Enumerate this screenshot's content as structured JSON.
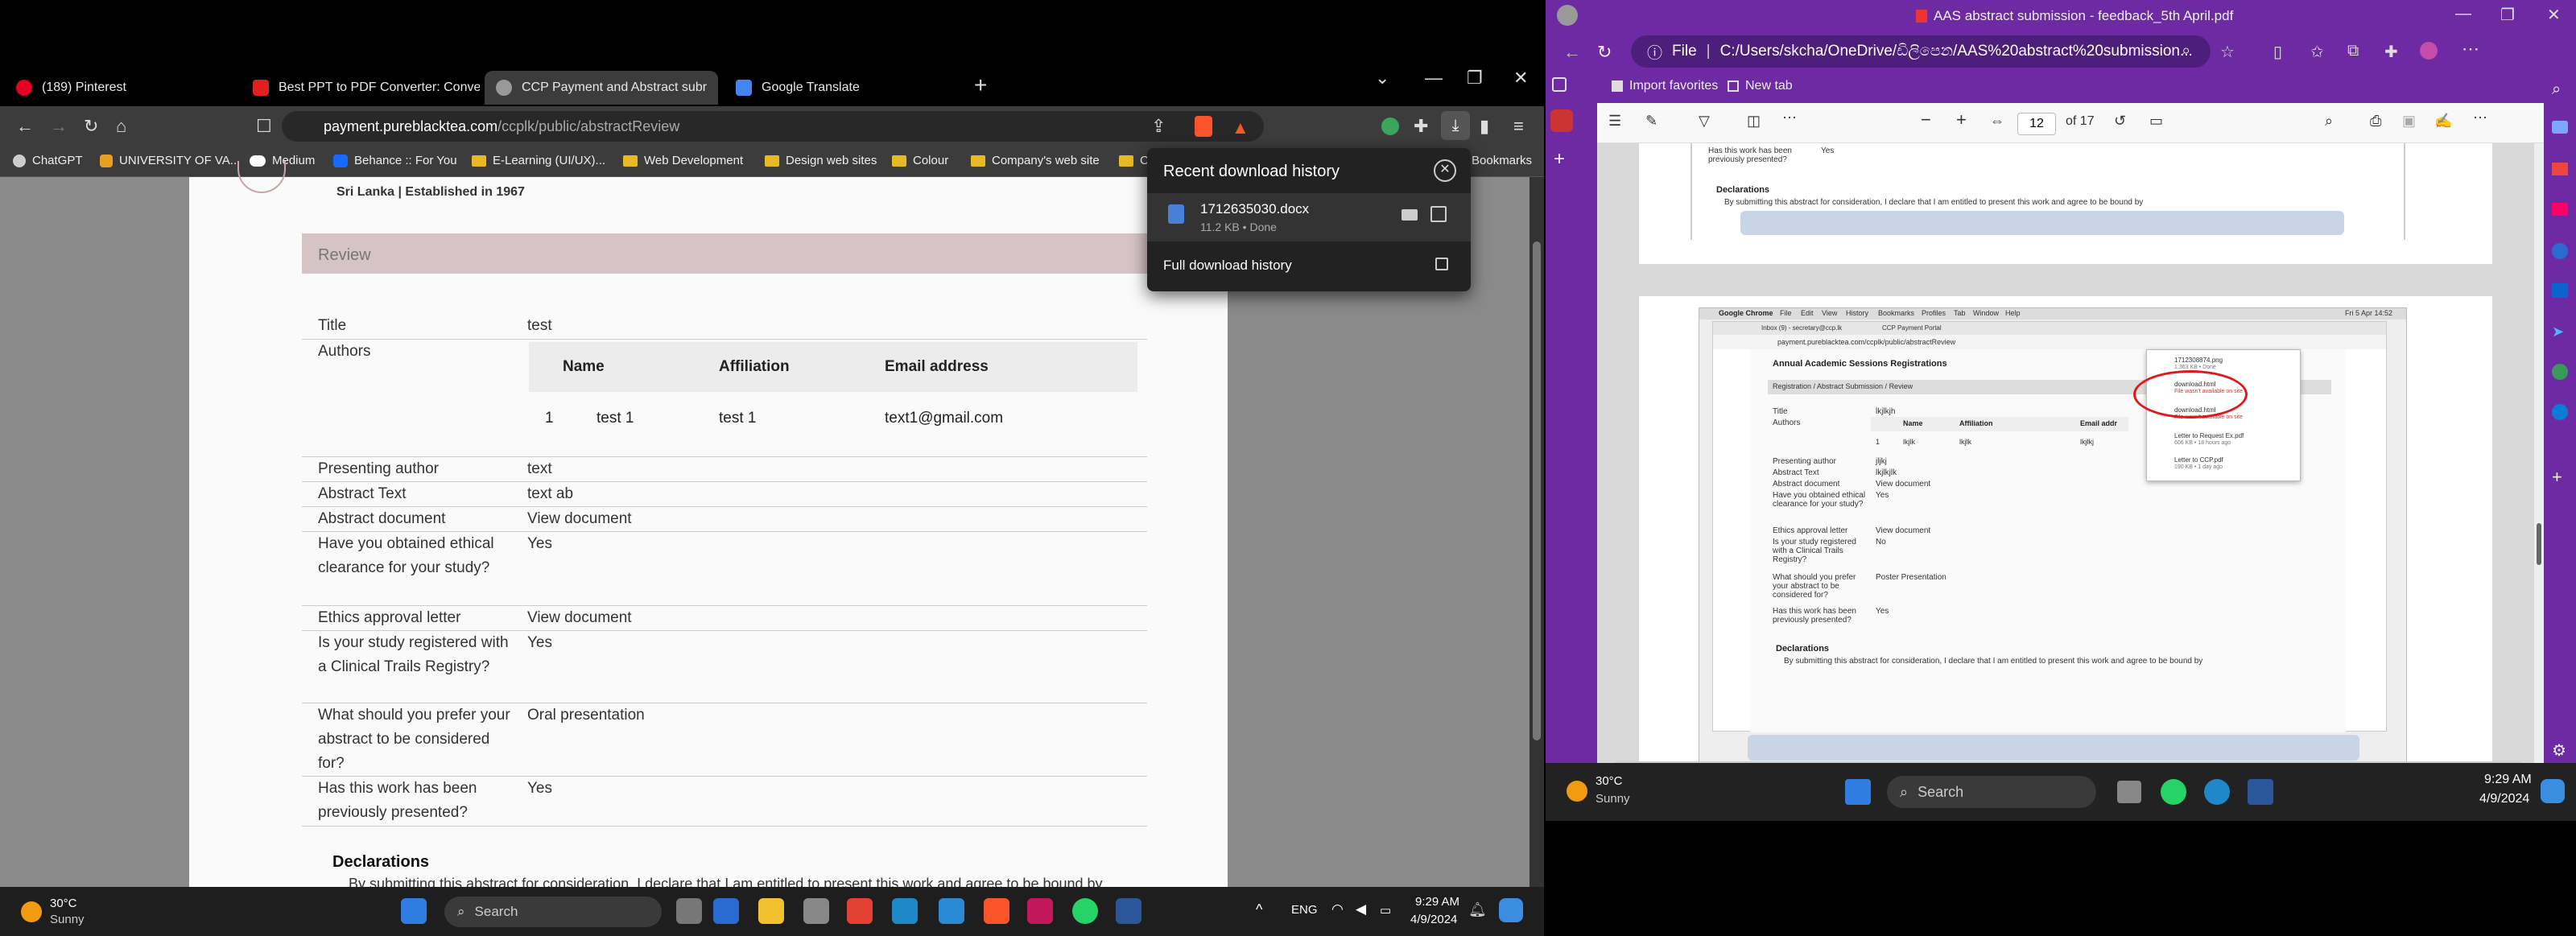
{
  "left_window": {
    "tabs": [
      {
        "label": "(189) Pinterest",
        "color": "#e60023"
      },
      {
        "label": "Best PPT to PDF Converter: Convert",
        "color": "#e02020"
      },
      {
        "label": "CCP Payment and Abstract subr",
        "color": "#888888"
      },
      {
        "label": "Google Translate",
        "color": "#4285f4"
      }
    ],
    "new_tab": "+",
    "url_domain": "payment.pureblacktea.com",
    "url_path": "/ccplk/public/abstractReview",
    "bookmarks": [
      "ChatGPT",
      "UNIVERSITY OF VA...",
      "Medium",
      "Behance :: For You",
      "E-Learning (UI/UX)...",
      "Web Development",
      "Design web sites",
      "Colour",
      "Company's web site",
      "C"
    ],
    "bookmarks_right": "Bookmarks",
    "page": {
      "established": "Sri Lanka | Established in 1967",
      "review_header": "Review",
      "rows": [
        {
          "label": "Title",
          "value": "test"
        },
        {
          "label": "Authors",
          "value": ""
        },
        {
          "label": "Presenting author",
          "value": "text"
        },
        {
          "label": "Abstract Text",
          "value": "text ab"
        },
        {
          "label": "Abstract document",
          "value": "View document"
        },
        {
          "label": "Have you obtained ethical clearance for your study?",
          "value": "Yes"
        },
        {
          "label": "Ethics approval letter",
          "value": "View document"
        },
        {
          "label": "Is your study registered with a Clinical Trails Registry?",
          "value": "Yes"
        },
        {
          "label": "What should you prefer your abstract to be considered for?",
          "value": "Oral presentation"
        },
        {
          "label": "Has this work has been previously presented?",
          "value": "Yes"
        }
      ],
      "authors_headers": [
        "Name",
        "Affiliation",
        "Email address"
      ],
      "authors_rows": [
        [
          "1",
          "test 1",
          "test 1",
          "text1@gmail.com"
        ]
      ],
      "declarations_title": "Declarations",
      "declarations_text": "By submitting this abstract for consideration, I declare that I am entitled to present this work and agree to be bound by"
    },
    "download_popup": {
      "title": "Recent download history",
      "file_name": "1712635030.docx",
      "file_meta": "11.2 KB • Done",
      "full_history": "Full download history"
    },
    "taskbar": {
      "temp": "30°C",
      "weather": "Sunny",
      "search": "Search",
      "lang": "ENG",
      "time": "9:29 AM",
      "date": "4/9/2024"
    }
  },
  "right_window": {
    "title": "AAS abstract submission - feedback_5th April.pdf",
    "url_label": "File",
    "url": "C:/Users/skcha/OneDrive/ඩිලිපෙන/AAS%20abstract%20submission...",
    "fav_items": [
      "Import favorites",
      "New tab"
    ],
    "page_current": "12",
    "page_total": "of 17",
    "top_page_rows": [
      {
        "label": "Has this work has been previously presented?",
        "value": "Yes"
      }
    ],
    "top_page_decl_title": "Declarations",
    "top_page_decl_text": "By submitting this abstract for consideration, I declare that I am entitled to present this work and agree to be bound by",
    "shot": {
      "menubar": [
        "Google Chrome",
        "File",
        "Edit",
        "View",
        "History",
        "Bookmarks",
        "Profiles",
        "Tab",
        "Window",
        "Help"
      ],
      "menubar_time": "Fri 5 Apr 14:52",
      "tabs": [
        "Inbox (9) - secretary@ccp.lk",
        "CCP Payment Portal"
      ],
      "url": "payment.pureblacktea.com/ccplk/public/abstractReview",
      "heading": "Annual Academic Sessions Registrations",
      "breadcrumb": "Registration  /  Abstract Submission  /  Review",
      "rows": [
        {
          "label": "Title",
          "value": "lkjlkjh"
        },
        {
          "label": "Authors",
          "value": ""
        },
        {
          "label": "Presenting author",
          "value": "jljkj"
        },
        {
          "label": "Abstract Text",
          "value": "lkjlkjlk"
        },
        {
          "label": "Abstract document",
          "value": "View document"
        },
        {
          "label": "Have you obtained ethical clearance for your study?",
          "value": "Yes"
        },
        {
          "label": "Ethics approval letter",
          "value": "View document"
        },
        {
          "label": "Is your study registered with a Clinical Trails Registry?",
          "value": "No"
        },
        {
          "label": "What should you prefer your abstract to be considered for?",
          "value": "Poster Presentation"
        },
        {
          "label": "Has this work has been previously presented?",
          "value": "Yes"
        }
      ],
      "authors_headers": [
        "Name",
        "Affiliation",
        "Email addr"
      ],
      "authors_row": [
        "1",
        "lkjlk",
        "lkjlk",
        "lkjlkj"
      ],
      "downloads": [
        {
          "name": "1712308874.png",
          "meta": "1,363 KB • Done"
        },
        {
          "name": "download.html",
          "meta": "File wasn't available on site"
        },
        {
          "name": "download.html",
          "meta": "File wasn't available on site"
        },
        {
          "name": "Letter to Request Ex.pdf",
          "meta": "606 KB • 18 hours ago"
        },
        {
          "name": "Letter to CCP.pdf",
          "meta": "190 KB • 1 day ago"
        }
      ],
      "decl_title": "Declarations",
      "decl_text": "By submitting this abstract for consideration, I declare that I am entitled to present this work and agree to be bound by"
    },
    "taskbar": {
      "temp": "30°C",
      "weather": "Sunny",
      "search": "Search",
      "time": "9:29 AM",
      "date": "4/9/2024"
    }
  }
}
